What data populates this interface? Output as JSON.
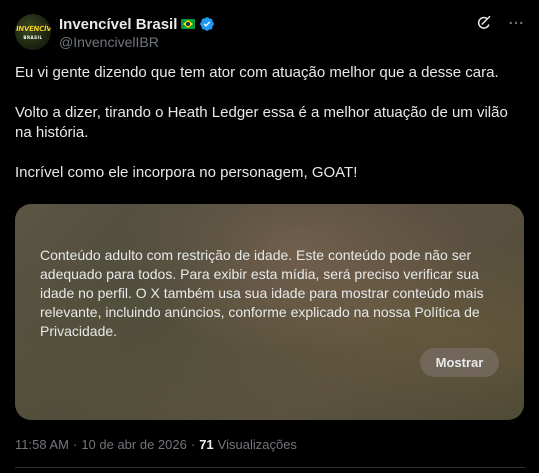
{
  "author": {
    "display_name": "Invencível Brasil",
    "handle": "@InvencivelIBR",
    "avatar_logo_text": "INVENCÍVEL",
    "avatar_logo_sub": "BRASIL",
    "flag_icon": "brazil-flag-icon",
    "verified_icon": "verified-badge-icon"
  },
  "header_actions": {
    "grok_icon": "grok-icon",
    "more_icon": "more-options-icon"
  },
  "post": {
    "paragraphs": [
      "Eu vi gente dizendo que tem ator com atuação melhor que a desse cara.",
      "Volto a dizer, tirando o Heath Ledger essa é a melhor atuação de um vilão na história.",
      "Incrível como ele incorpora no personagem, GOAT!"
    ]
  },
  "media": {
    "notice": "Conteúdo adulto com restrição de idade. Este conteúdo pode não ser adequado para todos. Para exibir esta mídia, será preciso verificar sua idade no perfil. O X também usa sua idade para mostrar conteúdo mais relevante, incluindo anúncios, conforme explicado na nossa Política de Privacidade.",
    "show_button": "Mostrar"
  },
  "meta": {
    "time": "11:58 AM",
    "separator": "·",
    "date": "10 de abr de 2026",
    "views_count": "71",
    "views_label": "Visualizações"
  },
  "colors": {
    "background": "#000000",
    "text": "#e7e9ea",
    "secondary_text": "#71767b",
    "verified": "#1d9bf0"
  }
}
